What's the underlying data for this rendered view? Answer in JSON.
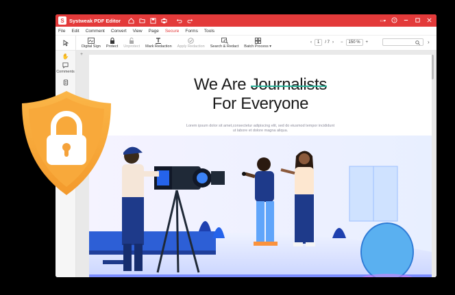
{
  "window": {
    "title": "Systweak PDF Editor",
    "logo_letter": "S"
  },
  "menu": [
    "File",
    "Edit",
    "Comment",
    "Convert",
    "View",
    "Page",
    "Secure",
    "Forms",
    "Tools"
  ],
  "menu_active": "Secure",
  "tools": [
    {
      "label": "Digital Sign",
      "icon": "digital-sign-icon",
      "enabled": true
    },
    {
      "label": "Protect",
      "icon": "lock-icon",
      "enabled": true
    },
    {
      "label": "Unprotect",
      "icon": "unlock-icon",
      "enabled": false
    },
    {
      "label": "Mark Redaction",
      "icon": "mark-redaction-icon",
      "enabled": true
    },
    {
      "label": "Apply Redaction",
      "icon": "apply-redaction-icon",
      "enabled": false
    },
    {
      "label": "Search & Redact",
      "icon": "search-redact-icon",
      "enabled": true
    },
    {
      "label": "Batch Process ▾",
      "icon": "batch-process-icon",
      "enabled": true
    }
  ],
  "pager": {
    "current": "1",
    "total": "/ 7",
    "zoom": "150 %"
  },
  "sidebar": {
    "comments_label": "Comments"
  },
  "page": {
    "title_line1_prefix": "We Are ",
    "title_line1_strike": "Journalists",
    "title_line2": "For Everyone",
    "lorem_line1": "Lorem ipsum dolor sit amet,consectetur adipiscing elit, sed do eiusmod tempor incididunt",
    "lorem_line2": "ut labore et dolore magna aliqua."
  },
  "colors": {
    "brand": "#e33a3a",
    "shield": "#f7a63a",
    "strike": "#2bb39a"
  }
}
